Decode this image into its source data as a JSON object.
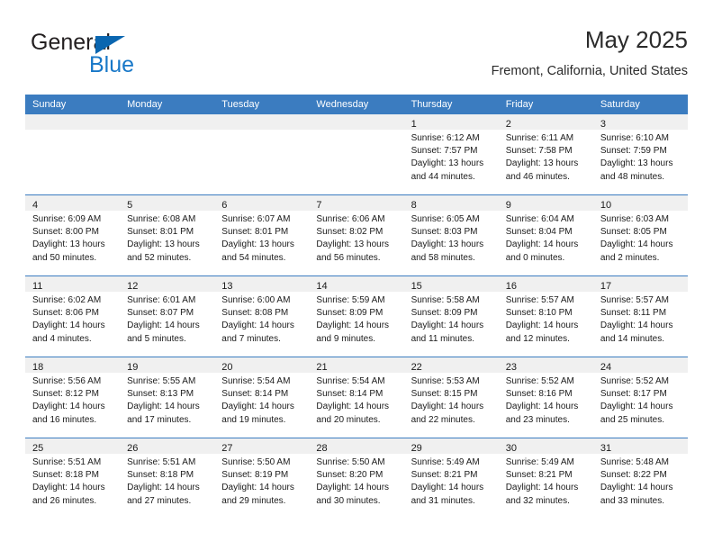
{
  "brand": {
    "name_top": "General",
    "name_bottom": "Blue",
    "triangle_color": "#0a66b0",
    "blue_color": "#1878c8"
  },
  "header": {
    "title": "May 2025",
    "subtitle": "Fremont, California, United States"
  },
  "theme": {
    "header_row_bg": "#3b7cc0",
    "daynum_band_bg": "#f0f0f0",
    "grid_line": "#3b7cc0"
  },
  "calendar": {
    "weekday_headers": [
      "Sunday",
      "Monday",
      "Tuesday",
      "Wednesday",
      "Thursday",
      "Friday",
      "Saturday"
    ],
    "weeks": [
      [
        {
          "day": "",
          "lines": []
        },
        {
          "day": "",
          "lines": []
        },
        {
          "day": "",
          "lines": []
        },
        {
          "day": "",
          "lines": []
        },
        {
          "day": "1",
          "lines": [
            "Sunrise: 6:12 AM",
            "Sunset: 7:57 PM",
            "Daylight: 13 hours",
            "and 44 minutes."
          ]
        },
        {
          "day": "2",
          "lines": [
            "Sunrise: 6:11 AM",
            "Sunset: 7:58 PM",
            "Daylight: 13 hours",
            "and 46 minutes."
          ]
        },
        {
          "day": "3",
          "lines": [
            "Sunrise: 6:10 AM",
            "Sunset: 7:59 PM",
            "Daylight: 13 hours",
            "and 48 minutes."
          ]
        }
      ],
      [
        {
          "day": "4",
          "lines": [
            "Sunrise: 6:09 AM",
            "Sunset: 8:00 PM",
            "Daylight: 13 hours",
            "and 50 minutes."
          ]
        },
        {
          "day": "5",
          "lines": [
            "Sunrise: 6:08 AM",
            "Sunset: 8:01 PM",
            "Daylight: 13 hours",
            "and 52 minutes."
          ]
        },
        {
          "day": "6",
          "lines": [
            "Sunrise: 6:07 AM",
            "Sunset: 8:01 PM",
            "Daylight: 13 hours",
            "and 54 minutes."
          ]
        },
        {
          "day": "7",
          "lines": [
            "Sunrise: 6:06 AM",
            "Sunset: 8:02 PM",
            "Daylight: 13 hours",
            "and 56 minutes."
          ]
        },
        {
          "day": "8",
          "lines": [
            "Sunrise: 6:05 AM",
            "Sunset: 8:03 PM",
            "Daylight: 13 hours",
            "and 58 minutes."
          ]
        },
        {
          "day": "9",
          "lines": [
            "Sunrise: 6:04 AM",
            "Sunset: 8:04 PM",
            "Daylight: 14 hours",
            "and 0 minutes."
          ]
        },
        {
          "day": "10",
          "lines": [
            "Sunrise: 6:03 AM",
            "Sunset: 8:05 PM",
            "Daylight: 14 hours",
            "and 2 minutes."
          ]
        }
      ],
      [
        {
          "day": "11",
          "lines": [
            "Sunrise: 6:02 AM",
            "Sunset: 8:06 PM",
            "Daylight: 14 hours",
            "and 4 minutes."
          ]
        },
        {
          "day": "12",
          "lines": [
            "Sunrise: 6:01 AM",
            "Sunset: 8:07 PM",
            "Daylight: 14 hours",
            "and 5 minutes."
          ]
        },
        {
          "day": "13",
          "lines": [
            "Sunrise: 6:00 AM",
            "Sunset: 8:08 PM",
            "Daylight: 14 hours",
            "and 7 minutes."
          ]
        },
        {
          "day": "14",
          "lines": [
            "Sunrise: 5:59 AM",
            "Sunset: 8:09 PM",
            "Daylight: 14 hours",
            "and 9 minutes."
          ]
        },
        {
          "day": "15",
          "lines": [
            "Sunrise: 5:58 AM",
            "Sunset: 8:09 PM",
            "Daylight: 14 hours",
            "and 11 minutes."
          ]
        },
        {
          "day": "16",
          "lines": [
            "Sunrise: 5:57 AM",
            "Sunset: 8:10 PM",
            "Daylight: 14 hours",
            "and 12 minutes."
          ]
        },
        {
          "day": "17",
          "lines": [
            "Sunrise: 5:57 AM",
            "Sunset: 8:11 PM",
            "Daylight: 14 hours",
            "and 14 minutes."
          ]
        }
      ],
      [
        {
          "day": "18",
          "lines": [
            "Sunrise: 5:56 AM",
            "Sunset: 8:12 PM",
            "Daylight: 14 hours",
            "and 16 minutes."
          ]
        },
        {
          "day": "19",
          "lines": [
            "Sunrise: 5:55 AM",
            "Sunset: 8:13 PM",
            "Daylight: 14 hours",
            "and 17 minutes."
          ]
        },
        {
          "day": "20",
          "lines": [
            "Sunrise: 5:54 AM",
            "Sunset: 8:14 PM",
            "Daylight: 14 hours",
            "and 19 minutes."
          ]
        },
        {
          "day": "21",
          "lines": [
            "Sunrise: 5:54 AM",
            "Sunset: 8:14 PM",
            "Daylight: 14 hours",
            "and 20 minutes."
          ]
        },
        {
          "day": "22",
          "lines": [
            "Sunrise: 5:53 AM",
            "Sunset: 8:15 PM",
            "Daylight: 14 hours",
            "and 22 minutes."
          ]
        },
        {
          "day": "23",
          "lines": [
            "Sunrise: 5:52 AM",
            "Sunset: 8:16 PM",
            "Daylight: 14 hours",
            "and 23 minutes."
          ]
        },
        {
          "day": "24",
          "lines": [
            "Sunrise: 5:52 AM",
            "Sunset: 8:17 PM",
            "Daylight: 14 hours",
            "and 25 minutes."
          ]
        }
      ],
      [
        {
          "day": "25",
          "lines": [
            "Sunrise: 5:51 AM",
            "Sunset: 8:18 PM",
            "Daylight: 14 hours",
            "and 26 minutes."
          ]
        },
        {
          "day": "26",
          "lines": [
            "Sunrise: 5:51 AM",
            "Sunset: 8:18 PM",
            "Daylight: 14 hours",
            "and 27 minutes."
          ]
        },
        {
          "day": "27",
          "lines": [
            "Sunrise: 5:50 AM",
            "Sunset: 8:19 PM",
            "Daylight: 14 hours",
            "and 29 minutes."
          ]
        },
        {
          "day": "28",
          "lines": [
            "Sunrise: 5:50 AM",
            "Sunset: 8:20 PM",
            "Daylight: 14 hours",
            "and 30 minutes."
          ]
        },
        {
          "day": "29",
          "lines": [
            "Sunrise: 5:49 AM",
            "Sunset: 8:21 PM",
            "Daylight: 14 hours",
            "and 31 minutes."
          ]
        },
        {
          "day": "30",
          "lines": [
            "Sunrise: 5:49 AM",
            "Sunset: 8:21 PM",
            "Daylight: 14 hours",
            "and 32 minutes."
          ]
        },
        {
          "day": "31",
          "lines": [
            "Sunrise: 5:48 AM",
            "Sunset: 8:22 PM",
            "Daylight: 14 hours",
            "and 33 minutes."
          ]
        }
      ]
    ]
  }
}
